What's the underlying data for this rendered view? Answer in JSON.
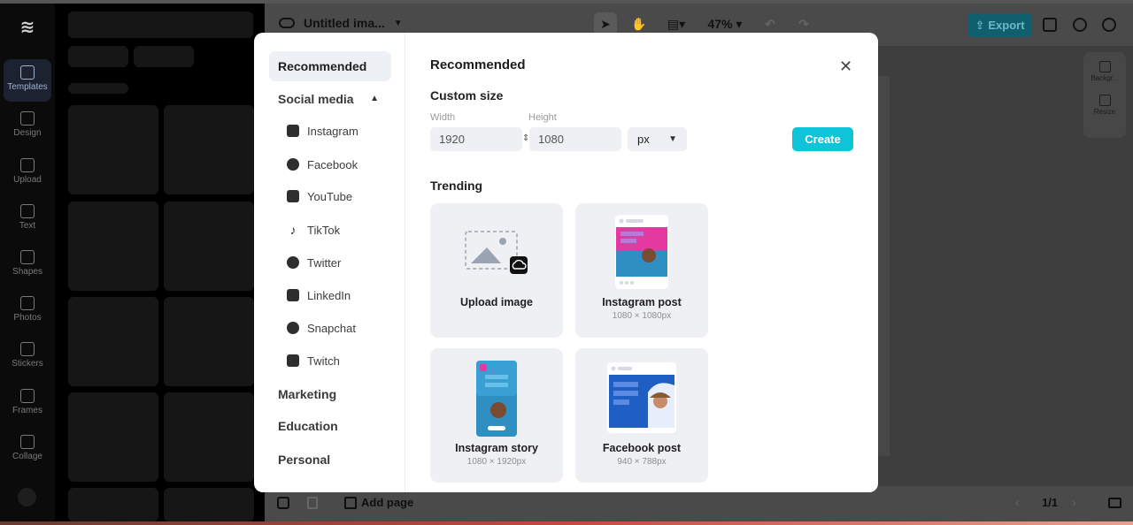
{
  "app": {
    "document_title": "Untitled ima...",
    "zoom": "47%",
    "export_label": "Export"
  },
  "rail": [
    {
      "label": "Templates",
      "icon": "templates-icon",
      "active": true
    },
    {
      "label": "Design",
      "icon": "design-icon"
    },
    {
      "label": "Upload",
      "icon": "upload-icon"
    },
    {
      "label": "Text",
      "icon": "text-icon"
    },
    {
      "label": "Shapes",
      "icon": "shapes-icon"
    },
    {
      "label": "Photos",
      "icon": "photos-icon"
    },
    {
      "label": "Stickers",
      "icon": "stickers-icon"
    },
    {
      "label": "Frames",
      "icon": "frames-icon"
    },
    {
      "label": "Collage",
      "icon": "collage-icon"
    }
  ],
  "right_panel": {
    "background": "Backgr...",
    "resize": "Resize"
  },
  "footer": {
    "add_page": "Add page",
    "pager": "1/1"
  },
  "modal": {
    "title": "Recommended",
    "nav": {
      "recommended": "Recommended",
      "social_media": "Social media",
      "social_items": [
        "Instagram",
        "Facebook",
        "YouTube",
        "TikTok",
        "Twitter",
        "LinkedIn",
        "Snapchat",
        "Twitch"
      ],
      "marketing": "Marketing",
      "education": "Education",
      "personal": "Personal"
    },
    "custom_size": {
      "heading": "Custom size",
      "width_label": "Width",
      "height_label": "Height",
      "width_value": "1920",
      "height_value": "1080",
      "unit": "px",
      "create_label": "Create"
    },
    "trending": {
      "heading": "Trending",
      "cards": [
        {
          "name": "Upload image",
          "dims": ""
        },
        {
          "name": "Instagram post",
          "dims": "1080 × 1080px"
        },
        {
          "name": "Instagram story",
          "dims": "1080 × 1920px"
        },
        {
          "name": "Facebook post",
          "dims": "940 × 788px"
        }
      ]
    }
  },
  "colors": {
    "accent": "#0fc4d8",
    "export_bg": "#0f5f6f",
    "modal_bg": "#ffffff",
    "card_bg": "#eef0f3"
  }
}
